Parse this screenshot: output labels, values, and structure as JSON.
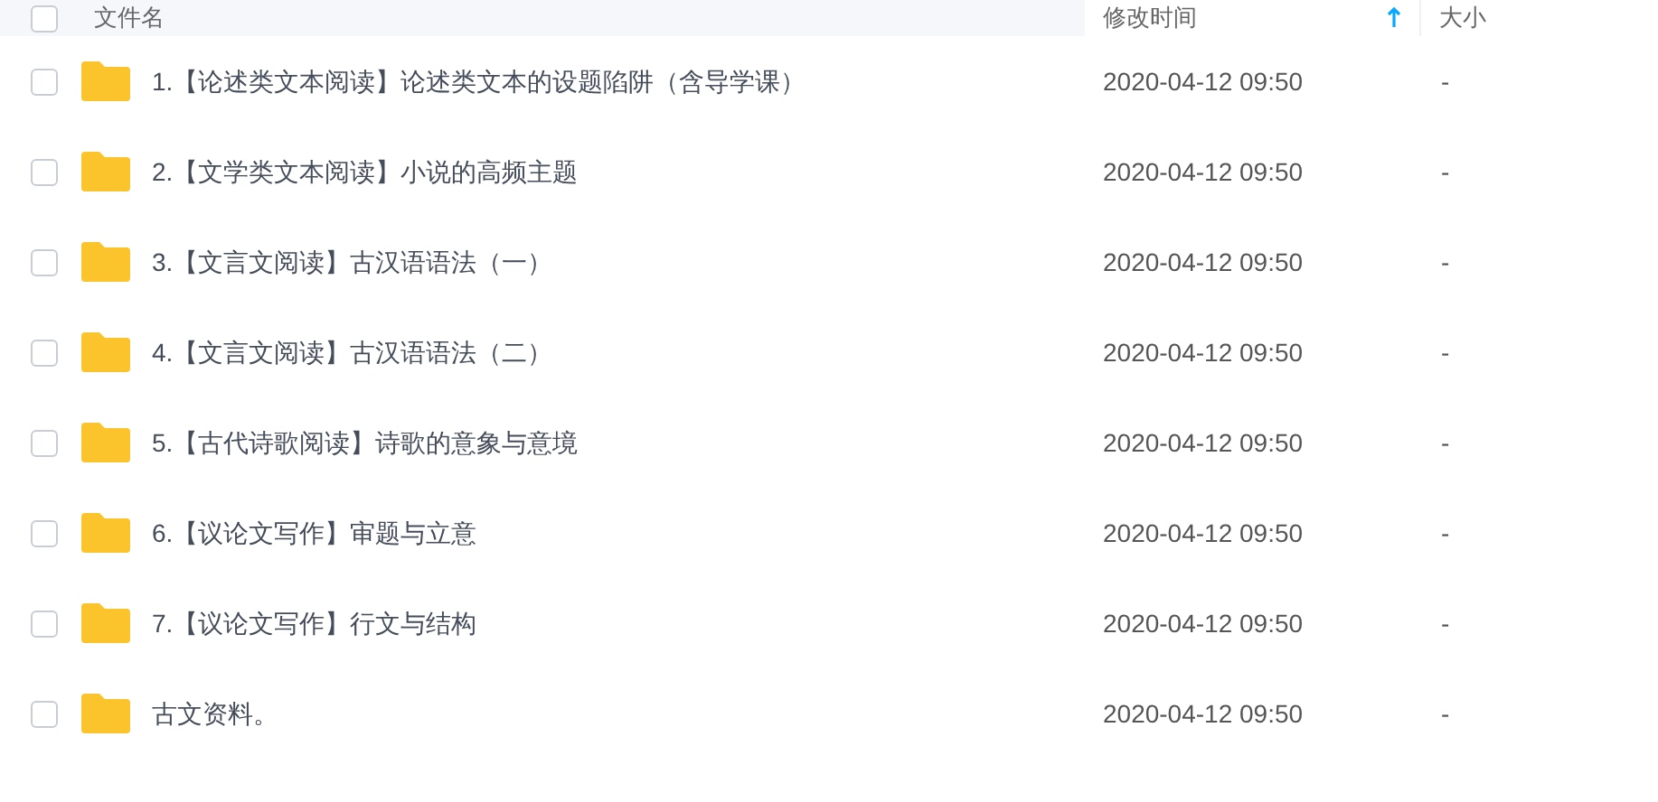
{
  "table": {
    "select_all": {
      "checked": false
    },
    "columns": [
      {
        "label": "文件名"
      },
      {
        "label": "修改时间",
        "sorted": true
      },
      {
        "label": "大小"
      }
    ],
    "rows": [
      {
        "name": "1.【论述类文本阅读】论述类文本的设题陷阱（含导学课）",
        "modified": "2020-04-12 09:50",
        "size": "-",
        "checked": false
      },
      {
        "name": "2.【文学类文本阅读】小说的高频主题",
        "modified": "2020-04-12 09:50",
        "size": "-",
        "checked": false
      },
      {
        "name": "3.【文言文阅读】古汉语语法（一）",
        "modified": "2020-04-12 09:50",
        "size": "-",
        "checked": false
      },
      {
        "name": "4.【文言文阅读】古汉语语法（二）",
        "modified": "2020-04-12 09:50",
        "size": "-",
        "checked": false
      },
      {
        "name": "5.【古代诗歌阅读】诗歌的意象与意境",
        "modified": "2020-04-12 09:50",
        "size": "-",
        "checked": false
      },
      {
        "name": "6.【议论文写作】审题与立意",
        "modified": "2020-04-12 09:50",
        "size": "-",
        "checked": false
      },
      {
        "name": "7.【议论文写作】行文与结构",
        "modified": "2020-04-12 09:50",
        "size": "-",
        "checked": false
      },
      {
        "name": "古文资料。",
        "modified": "2020-04-12 09:50",
        "size": "-",
        "checked": false
      }
    ]
  }
}
